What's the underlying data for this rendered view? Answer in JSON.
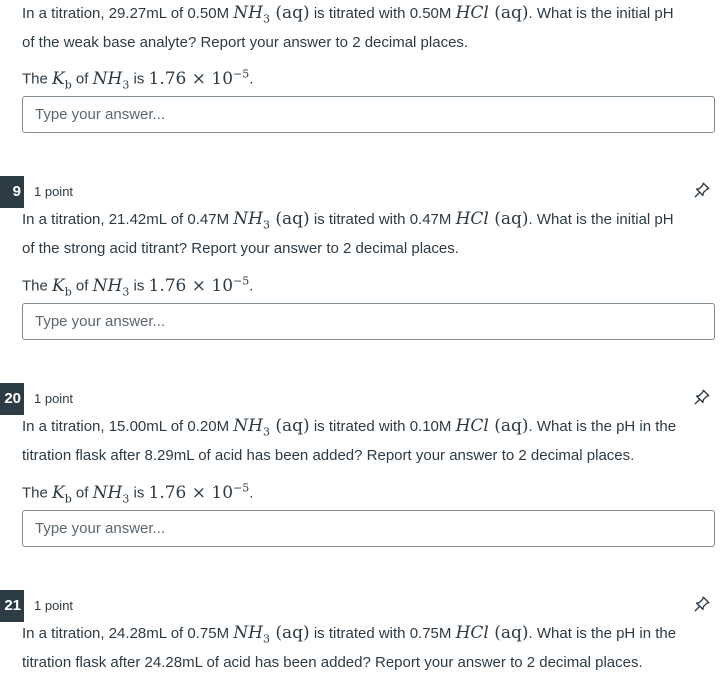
{
  "answer_placeholder": "Type your answer...",
  "kb_prefix": "The ",
  "kb_mid": " of ",
  "kb_is": " is ",
  "kb_symbol": "K",
  "kb_sub": "b",
  "nh3": "NH",
  "nh3_sub": "3",
  "aq": "(aq)",
  "hcl": "HCl",
  "kb_value": "1.76 × 10",
  "kb_exp": "−5",
  "in_a_titration": "In a titration, ",
  "questions": [
    {
      "number": "",
      "points": "",
      "base_volume": "29.27mL of 0.50M ",
      "titrated_with": " is titrated with 0.50M ",
      "question_line1": ". What is the initial pH",
      "question_line2": "of the weak base analyte? Report your answer to 2 decimal places."
    },
    {
      "number": "9",
      "points": "1 point",
      "base_volume": "21.42mL of 0.47M ",
      "titrated_with": " is titrated with 0.47M ",
      "question_line1": ". What is the initial pH",
      "question_line2": "of the strong acid titrant? Report your answer to 2 decimal places."
    },
    {
      "number": "20",
      "points": "1 point",
      "base_volume": "15.00mL of 0.20M ",
      "titrated_with": " is titrated with 0.10M ",
      "question_line1": ". What is the pH in the",
      "question_line2": "titration flask after 8.29mL of acid has been added? Report your answer to 2 decimal places."
    },
    {
      "number": "21",
      "points": "1 point",
      "base_volume": "24.28mL of 0.75M ",
      "titrated_with": " is titrated with 0.75M ",
      "question_line1": ". What is the pH in the",
      "question_line2": "titration flask after 24.28mL of acid has been added? Report your answer to 2 decimal places."
    }
  ]
}
